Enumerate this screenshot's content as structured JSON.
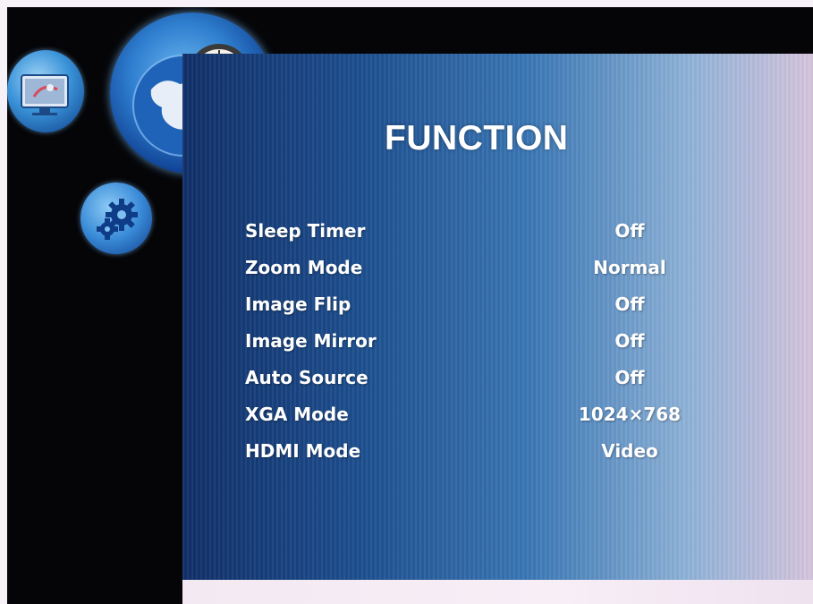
{
  "menu": {
    "title": "FUNCTION",
    "items": [
      {
        "label": "Sleep Timer",
        "value": "Off"
      },
      {
        "label": "Zoom Mode",
        "value": "Normal"
      },
      {
        "label": "Image Flip",
        "value": "Off"
      },
      {
        "label": "Image Mirror",
        "value": "Off"
      },
      {
        "label": "Auto Source",
        "value": "Off"
      },
      {
        "label": "XGA Mode",
        "value": "1024×768"
      },
      {
        "label": "HDMI Mode",
        "value": "Video"
      }
    ]
  },
  "icons": {
    "display": "monitor-icon",
    "function": "globe-clock-icon",
    "settings": "gear-icon",
    "decoration": "bubbles-decoration"
  },
  "colors": {
    "background": "#050507",
    "panel_start": "#11306a",
    "panel_end": "#d7c6df",
    "text": "#ffffff"
  }
}
